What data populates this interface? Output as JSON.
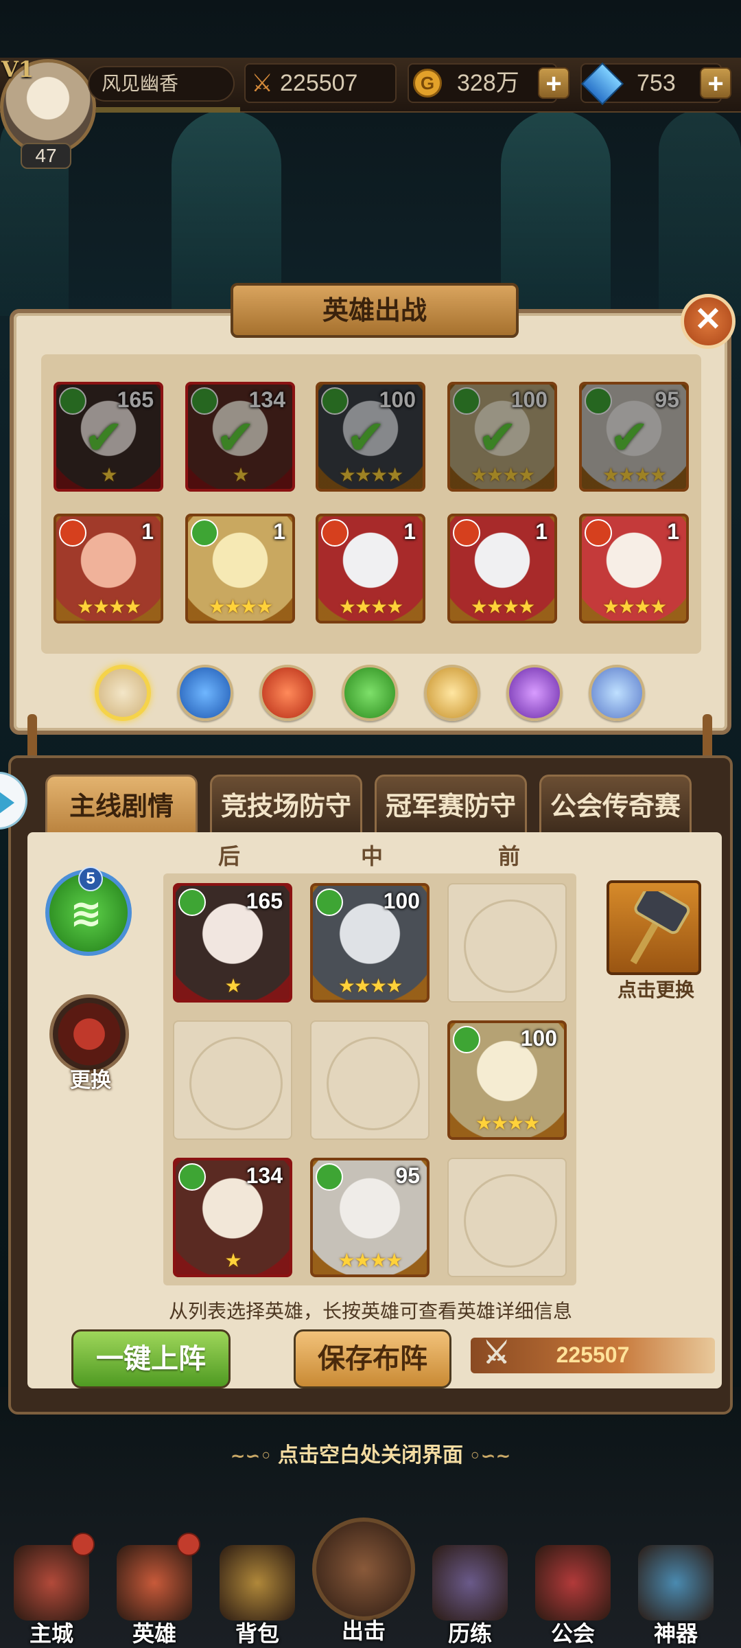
{
  "player": {
    "vip": "V1",
    "level": "47",
    "name": "风见幽香",
    "power": "225507",
    "gold": "328万",
    "gems": "753"
  },
  "dialog_title": "英雄出战",
  "top_heroes": [
    {
      "level": "165",
      "rarity": "red",
      "element": "wind",
      "stars": "★",
      "deployed": true
    },
    {
      "level": "134",
      "rarity": "red",
      "element": "wind",
      "stars": "★",
      "deployed": true
    },
    {
      "level": "100",
      "rarity": "gold",
      "element": "wind",
      "stars": "★★★★",
      "deployed": true
    },
    {
      "level": "100",
      "rarity": "gold",
      "element": "wind",
      "stars": "★★★★",
      "deployed": true
    },
    {
      "level": "95",
      "rarity": "gold",
      "element": "wind",
      "stars": "★★★★",
      "deployed": true
    },
    {
      "level": "1",
      "rarity": "gold",
      "element": "fire",
      "stars": "★★★★",
      "deployed": false
    },
    {
      "level": "1",
      "rarity": "gold",
      "element": "wind",
      "stars": "★★★★",
      "deployed": false
    },
    {
      "level": "1",
      "rarity": "gold",
      "element": "fire",
      "stars": "★★★★",
      "deployed": false
    },
    {
      "level": "1",
      "rarity": "gold",
      "element": "fire",
      "stars": "★★★★",
      "deployed": false
    },
    {
      "level": "1",
      "rarity": "gold",
      "element": "fire",
      "stars": "★★★★",
      "deployed": false
    }
  ],
  "element_filters": [
    "all",
    "water",
    "fire",
    "wind",
    "light",
    "dark",
    "void"
  ],
  "tabs": [
    "主线剧情",
    "竞技场防守",
    "冠军赛防守",
    "公会传奇赛"
  ],
  "columns": {
    "back": "后",
    "middle": "中",
    "front": "前"
  },
  "formation": {
    "r1c1": {
      "level": "165",
      "stars": "★"
    },
    "r1c2": {
      "level": "100",
      "stars": "★★★★"
    },
    "r2c3": {
      "level": "100",
      "stars": "★★★★"
    },
    "r3c1": {
      "level": "134",
      "stars": "★"
    },
    "r3c2": {
      "level": "95",
      "stars": "★★★★"
    }
  },
  "wind_badge": "5",
  "swap_label": "更换",
  "artifact_label": "点击更换",
  "hint": "从列表选择英雄，长按英雄可查看英雄详细信息",
  "auto_button": "一键上阵",
  "save_button": "保存布阵",
  "team_power": "225507",
  "close_hint": "点击空白处关闭界面",
  "nav": [
    "主城",
    "英雄",
    "背包",
    "出击",
    "历练",
    "公会",
    "神器"
  ],
  "colors": {
    "wind": "#3ea534",
    "fire": "#d6401e",
    "water": "#2a74c9",
    "gold_frame": "#d98a24",
    "red_frame": "#b51f1f"
  }
}
